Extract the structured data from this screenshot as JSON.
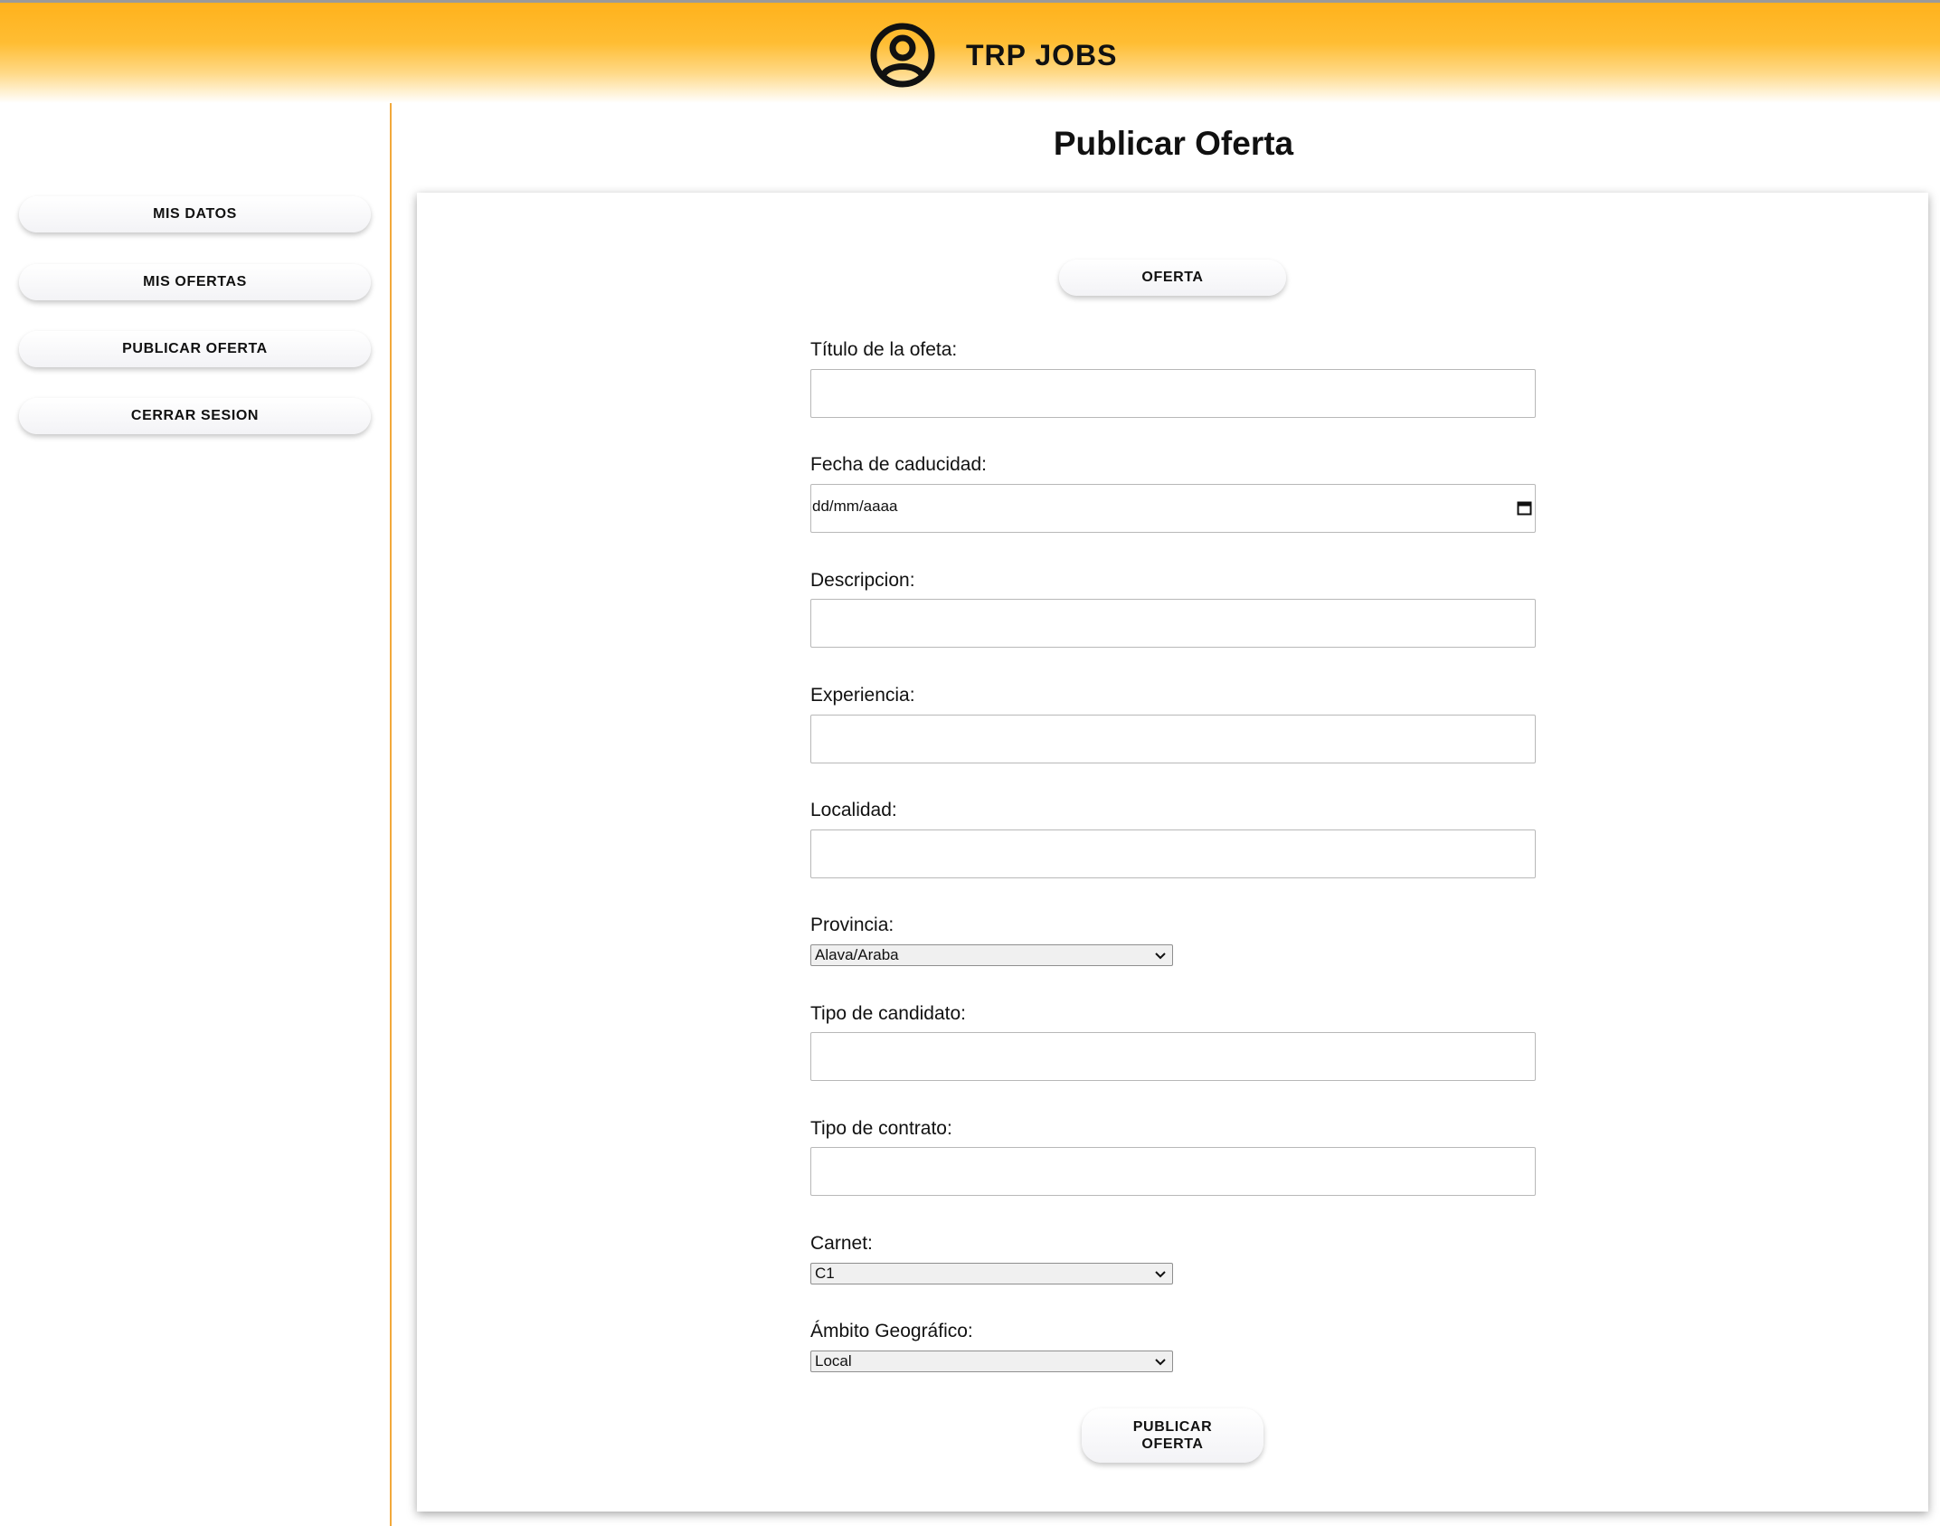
{
  "header": {
    "brand": "TRP JOBS",
    "icon": "user-circle-icon",
    "accent_color": "#ffb21c"
  },
  "sidebar": {
    "divider_color": "#f2a93b",
    "items": [
      {
        "label": "MIS DATOS"
      },
      {
        "label": "MIS OFERTAS"
      },
      {
        "label": "PUBLICAR OFERTA"
      },
      {
        "label": "CERRAR SESION"
      }
    ]
  },
  "main": {
    "title": "Publicar Oferta",
    "section_button": "OFERTA",
    "form": {
      "titulo_label": "Título de la ofeta:",
      "fecha_label": "Fecha de caducidad:",
      "fecha_placeholder": "dd/mm/aaaa",
      "descripcion_label": "Descripcion:",
      "experiencia_label": "Experiencia:",
      "localidad_label": "Localidad:",
      "provincia_label": "Provincia:",
      "provincia_value": "Alava/Araba",
      "tipo_candidato_label": "Tipo de candidato:",
      "tipo_contrato_label": "Tipo de contrato:",
      "carnet_label": "Carnet:",
      "carnet_value": "C1",
      "ambito_label": "Ámbito Geográfico:",
      "ambito_value": "Local"
    },
    "submit_line1": "PUBLICAR",
    "submit_line2": "OFERTA"
  }
}
